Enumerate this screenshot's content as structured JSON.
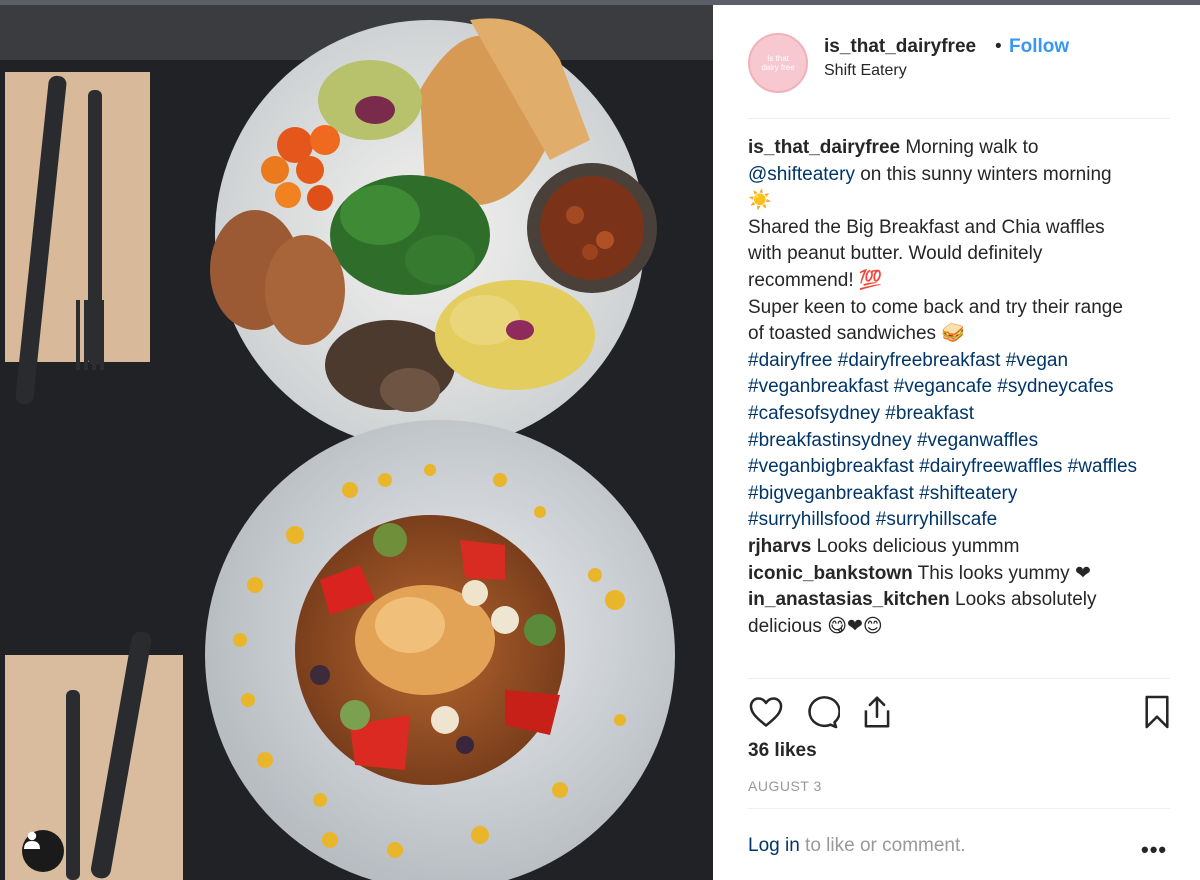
{
  "post": {
    "username": "is_that_dairyfree",
    "separator": "•",
    "follow_label": "Follow",
    "location": "Shift Eatery",
    "avatar_text": "Is that dairy free"
  },
  "caption": {
    "username": "is_that_dairyfree",
    "line1_text": " Morning walk to",
    "mention": "@shifteatery",
    "line2_text": " on this sunny winters morning",
    "line3_text": "☀️",
    "line4_text": "Shared the Big Breakfast and Chia waffles",
    "line5_text": "with peanut butter. Would definitely",
    "line6_text": "recommend! 💯",
    "line7_text": "Super keen to come back and try their range",
    "line8_text": "of toasted sandwiches 🥪",
    "hashtag_lines": [
      "#dairyfree #dairyfreebreakfast #vegan",
      "#veganbreakfast #vegancafe #sydneycafes",
      "#cafesofsydney #breakfast",
      "#breakfastinsydney #veganwaffles",
      "#veganbigbreakfast #dairyfreewaffles #waffles",
      "#bigveganbreakfast #shifteatery",
      "#surryhillsfood #surryhillscafe"
    ]
  },
  "comments": [
    {
      "user": "rjharvs",
      "text": " Looks delicious yummm"
    },
    {
      "user": "iconic_bankstown",
      "text": " This looks yummy ❤"
    },
    {
      "user": "in_anastasias_kitchen",
      "text": " Looks absolutely",
      "text2": "delicious 😋❤😊"
    }
  ],
  "actions": {
    "like_icon": "heart-icon",
    "comment_icon": "comment-bubble-icon",
    "share_icon": "share-icon",
    "save_icon": "bookmark-icon"
  },
  "likes": "36 likes",
  "date": "AUGUST 3",
  "footer": {
    "login_label": "Log in",
    "login_suffix": " to like or comment.",
    "more_label": "•••"
  },
  "colors": {
    "link_blue": "#003569",
    "follow_blue": "#3897f0",
    "muted": "#999999",
    "text": "#262626"
  }
}
